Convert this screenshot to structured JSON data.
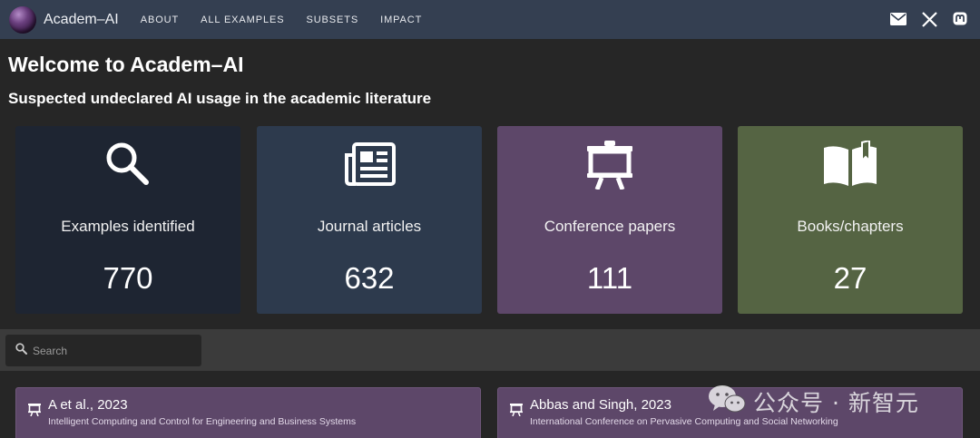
{
  "navbar": {
    "brand": "Academ–AI",
    "links": [
      "ABOUT",
      "ALL EXAMPLES",
      "SUBSETS",
      "IMPACT"
    ],
    "icons": [
      "email-icon",
      "x-icon",
      "mastodon-icon"
    ]
  },
  "header": {
    "title": "Welcome to Academ–AI",
    "subtitle": "Suspected undeclared AI usage in the academic literature"
  },
  "stats": [
    {
      "label": "Examples identified",
      "value": "770",
      "icon": "search-icon",
      "color": "#1e2532"
    },
    {
      "label": "Journal articles",
      "value": "632",
      "icon": "newspaper-icon",
      "color": "#2d3a4d"
    },
    {
      "label": "Conference papers",
      "value": "111",
      "icon": "presentation-icon",
      "color": "#5d4769"
    },
    {
      "label": "Books/chapters",
      "value": "27",
      "icon": "book-icon",
      "color": "#556443"
    }
  ],
  "search": {
    "placeholder": "Search"
  },
  "results": [
    {
      "title": "A et al., 2023",
      "venue": "Intelligent Computing and Control for Engineering and Business Systems",
      "icon": "presentation-icon"
    },
    {
      "title": "Abbas and Singh, 2023",
      "venue": "International Conference on Pervasive Computing and Social Networking",
      "icon": "presentation-icon"
    }
  ],
  "watermark": {
    "text": "公众号 · 新智元"
  }
}
